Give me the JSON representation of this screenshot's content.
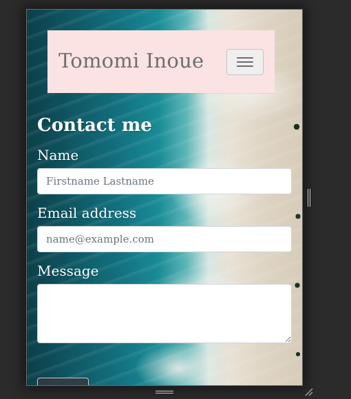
{
  "navbar": {
    "brand": "Tomomi Inoue",
    "toggler_icon": "hamburger-icon"
  },
  "contact": {
    "title": "Contact me",
    "name": {
      "label": "Name",
      "placeholder": "Firstname Lastname",
      "value": ""
    },
    "email": {
      "label": "Email address",
      "placeholder": "name@example.com",
      "value": ""
    },
    "message": {
      "label": "Message",
      "placeholder": "",
      "value": ""
    },
    "submit_label": ""
  },
  "viewport_handles": {
    "side": "resize-handle-vertical-icon",
    "bottom": "resize-handle-horizontal-icon",
    "corner": "resize-corner-icon"
  },
  "colors": {
    "page_background": "#2b2b2b",
    "navbar_background": "#fbe3e3",
    "brand_text": "#6f6f6f",
    "label_text": "#ffffff"
  }
}
